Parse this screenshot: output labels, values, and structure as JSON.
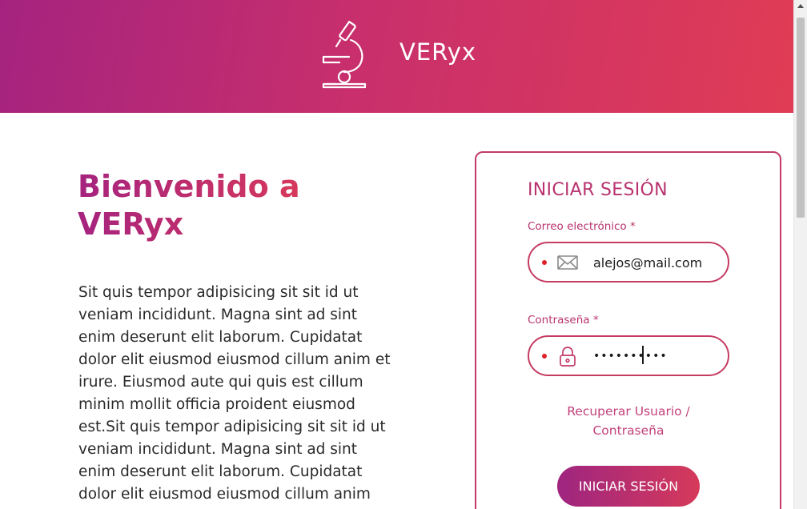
{
  "header": {
    "brand": "VERyx",
    "logo_icon": "microscope-icon"
  },
  "welcome": {
    "heading": "Bienvenido a VERyx",
    "body": "Sit quis tempor adipisicing sit sit id ut veniam incididunt. Magna sint ad sint enim deserunt elit laborum. Cupidatat dolor elit eiusmod eiusmod cillum anim et irure. Eiusmod aute qui quis est cillum minim mollit officia proident eiusmod est.Sit quis tempor adipisicing sit sit id ut veniam incididunt. Magna sint ad sint enim deserunt elit laborum. Cupidatat dolor elit eiusmod eiusmod cillum anim"
  },
  "login": {
    "title": "INICIAR SESIÓN",
    "email": {
      "label": "Correo electrónico *",
      "value": "alejos@mail.com",
      "icon": "envelope-icon"
    },
    "password": {
      "label": "Contraseña *",
      "value": "••••••••••",
      "icon": "lock-icon"
    },
    "recover_link": "Recuperar Usuario / Contraseña",
    "submit_label": "INICIAR SESIÓN"
  },
  "colors": {
    "gradient_start": "#a5237f",
    "gradient_end": "#e03c55",
    "accent": "#c23a6a",
    "required_dot": "#e0202a"
  }
}
